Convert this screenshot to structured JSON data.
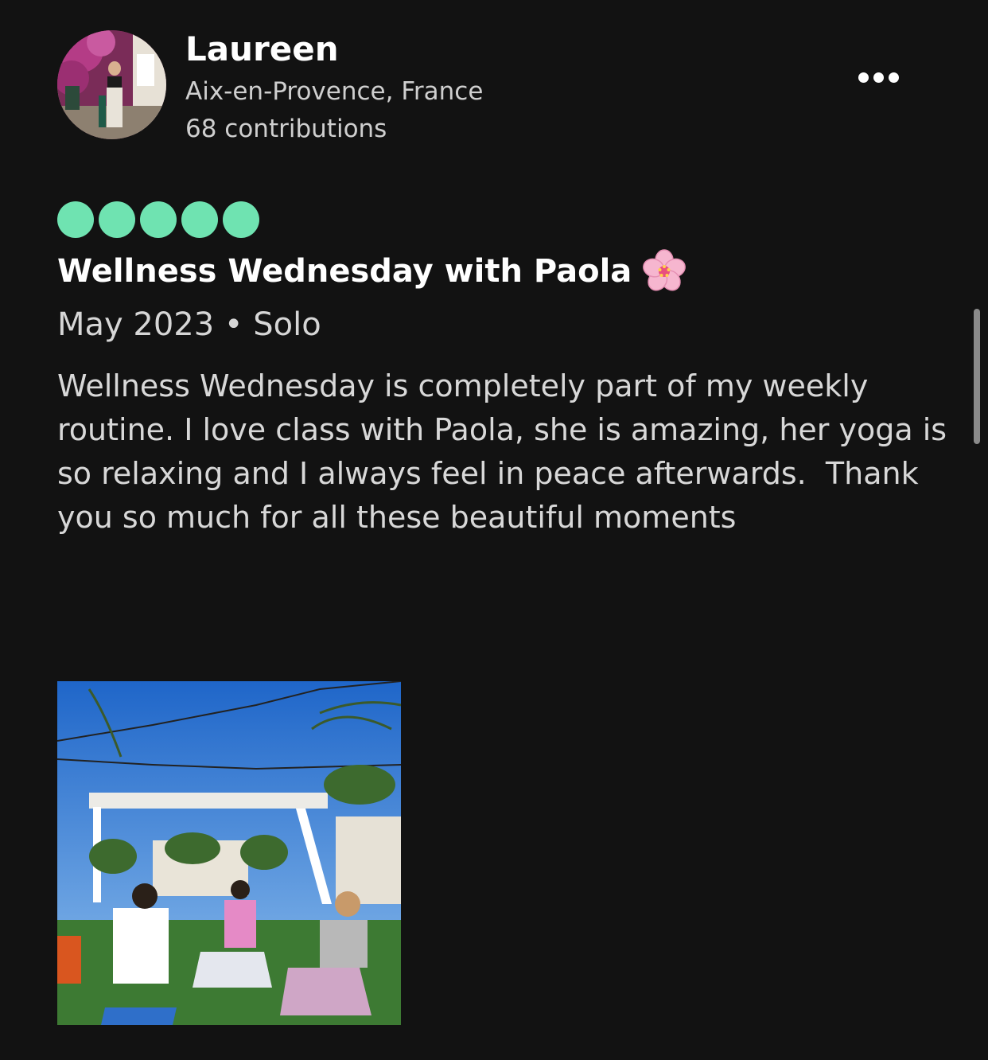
{
  "reviewer": {
    "name": "Laureen",
    "location": "Aix-en-Provence, France",
    "contributions": "68 contributions"
  },
  "review": {
    "rating": 5,
    "rating_max": 5,
    "title": "Wellness Wednesday with Paola",
    "title_emoji": "cherry-blossom-icon",
    "meta": "May 2023 • Solo",
    "body": "Wellness Wednesday is completely part of my weekly routine. I love class with Paola, she is amazing, her yoga is so relaxing and I always feel in peace afterwards.  Thank you so much for all these beautiful moments"
  },
  "icons": {
    "more": "more-options-icon"
  },
  "colors": {
    "background": "#121212",
    "rating_bubble": "#6fe3b1",
    "text_primary": "#ffffff",
    "text_secondary": "#d6d6d6"
  }
}
